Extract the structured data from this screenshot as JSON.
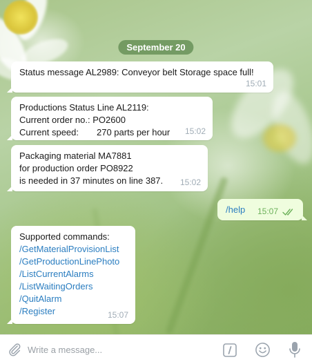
{
  "date_label": "September 20",
  "messages": [
    {
      "direction": "in",
      "lines": [
        "Status message AL2989: Conveyor belt Storage space full!"
      ],
      "time": "15:01"
    },
    {
      "direction": "in",
      "lines": [
        "Productions Status Line AL2119:",
        "Current order no.: PO2600"
      ],
      "speed_label": "Current speed:",
      "speed_value": "270 parts per hour",
      "time": "15:02"
    },
    {
      "direction": "in",
      "lines": [
        "Packaging material MA7881",
        "for production order PO8922",
        "is needed in 37 minutes on line 387."
      ],
      "time": "15:02"
    },
    {
      "direction": "out",
      "text": "/help",
      "time": "15:07",
      "status": "read"
    },
    {
      "direction": "in",
      "heading": "Supported commands:",
      "commands": [
        "/GetMaterialProvisionList",
        "/GetProductionLinePhoto",
        "/ListCurrentAlarms",
        "/ListWaitingOrders",
        "/QuitAlarm",
        "/Register"
      ],
      "time": "15:07"
    }
  ],
  "composer": {
    "placeholder": "Write a message..."
  },
  "icons": {
    "attach": "paperclip-icon",
    "commands": "slash-command-icon",
    "emoji": "smiley-icon",
    "voice": "microphone-icon",
    "read_status": "double-check-icon"
  },
  "colors": {
    "date_pill_bg": "#628c52",
    "outgoing_bubble": "#effdde",
    "incoming_bubble": "#ffffff",
    "link": "#2a7dc0",
    "outgoing_time": "#6cb15a",
    "icon_gray": "#9aa3ad"
  }
}
